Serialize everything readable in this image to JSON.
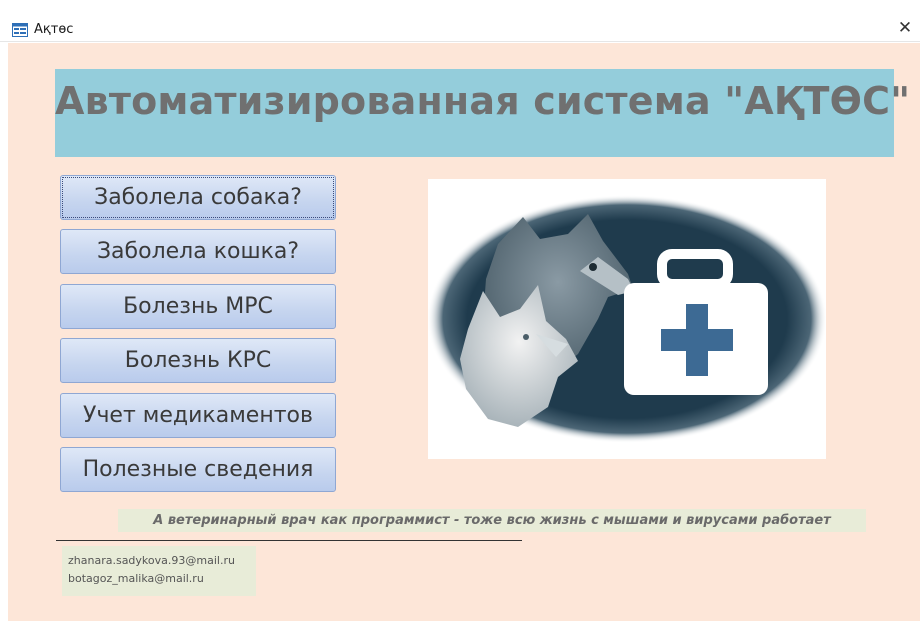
{
  "window": {
    "title": "Ақтөс",
    "app_icon": "form-icon",
    "close_icon": "close-icon",
    "close_glyph": "✕"
  },
  "header": {
    "title": "Автоматизированная система \"АҚТӨС\""
  },
  "menu": {
    "buttons": [
      "Заболела собака?",
      "Заболела кошка?",
      "Болезнь МРС",
      "Болезнь КРС",
      "Учет медикаментов",
      "Полезные сведения"
    ]
  },
  "illustration": {
    "icon": "vet-dog-cat-medical-kit-image",
    "colors": {
      "oval": "#1f3b4d",
      "cross": "#3d6a94",
      "kit": "#ffffff"
    }
  },
  "footer": {
    "motto": "А ветеринарный врач как программист - тоже всю жизнь с мышами и вирусами работает",
    "contacts": [
      "zhanara.sadykova.93@mail.ru",
      "botagoz_malika@mail.ru"
    ]
  },
  "colors": {
    "form_background": "#fde6d8",
    "banner_background": "#94cddb",
    "title_text": "#707070",
    "button_fill": "#c6d5ef",
    "note_background": "#e8ecd8"
  }
}
